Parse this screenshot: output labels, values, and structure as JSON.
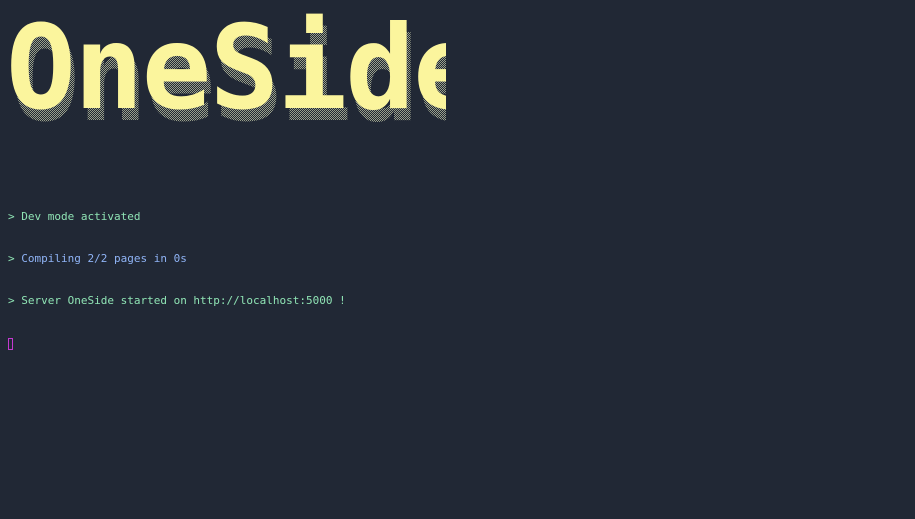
{
  "banner": {
    "title": "OneSide",
    "color": "#fbf59d",
    "shadow_color": "#5a5f52"
  },
  "log": {
    "prompt_symbol": ">",
    "lines": [
      {
        "text": " Dev mode activated",
        "color": "#8fe3b4"
      },
      {
        "text": " Compiling 2/2 pages in 0s",
        "color": "#8fb3f5"
      },
      {
        "text": " Server OneSide started on http://localhost:5000 !",
        "color": "#8fe3b4"
      }
    ]
  },
  "cursor": {
    "color": "#c43ad0"
  },
  "background": "#212835"
}
